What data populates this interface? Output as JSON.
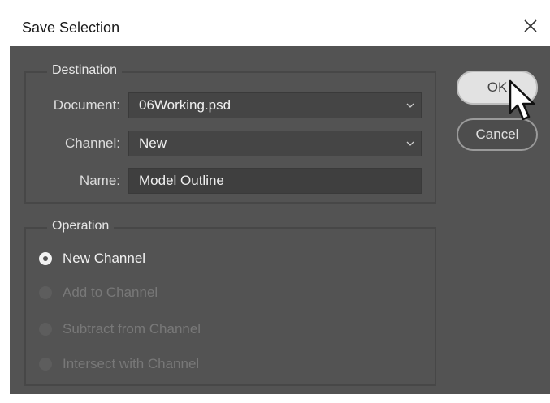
{
  "window": {
    "title": "Save Selection"
  },
  "destination": {
    "legend": "Destination",
    "document_label": "Document:",
    "document_value": "06Working.psd",
    "channel_label": "Channel:",
    "channel_value": "New",
    "name_label": "Name:",
    "name_value": "Model Outline"
  },
  "operation": {
    "legend": "Operation",
    "options": [
      {
        "label": "New Channel",
        "selected": true,
        "enabled": true
      },
      {
        "label": "Add to Channel",
        "selected": false,
        "enabled": false
      },
      {
        "label": "Subtract from Channel",
        "selected": false,
        "enabled": false
      },
      {
        "label": "Intersect with Channel",
        "selected": false,
        "enabled": false
      }
    ]
  },
  "buttons": {
    "ok": "OK",
    "cancel": "Cancel"
  },
  "colors": {
    "panel": "#535353",
    "field": "#454545",
    "text": "#dcdcdc",
    "disabled_text": "#787878"
  },
  "icons": [
    "close-icon",
    "chevron-down-icon",
    "mouse-pointer-icon"
  ]
}
